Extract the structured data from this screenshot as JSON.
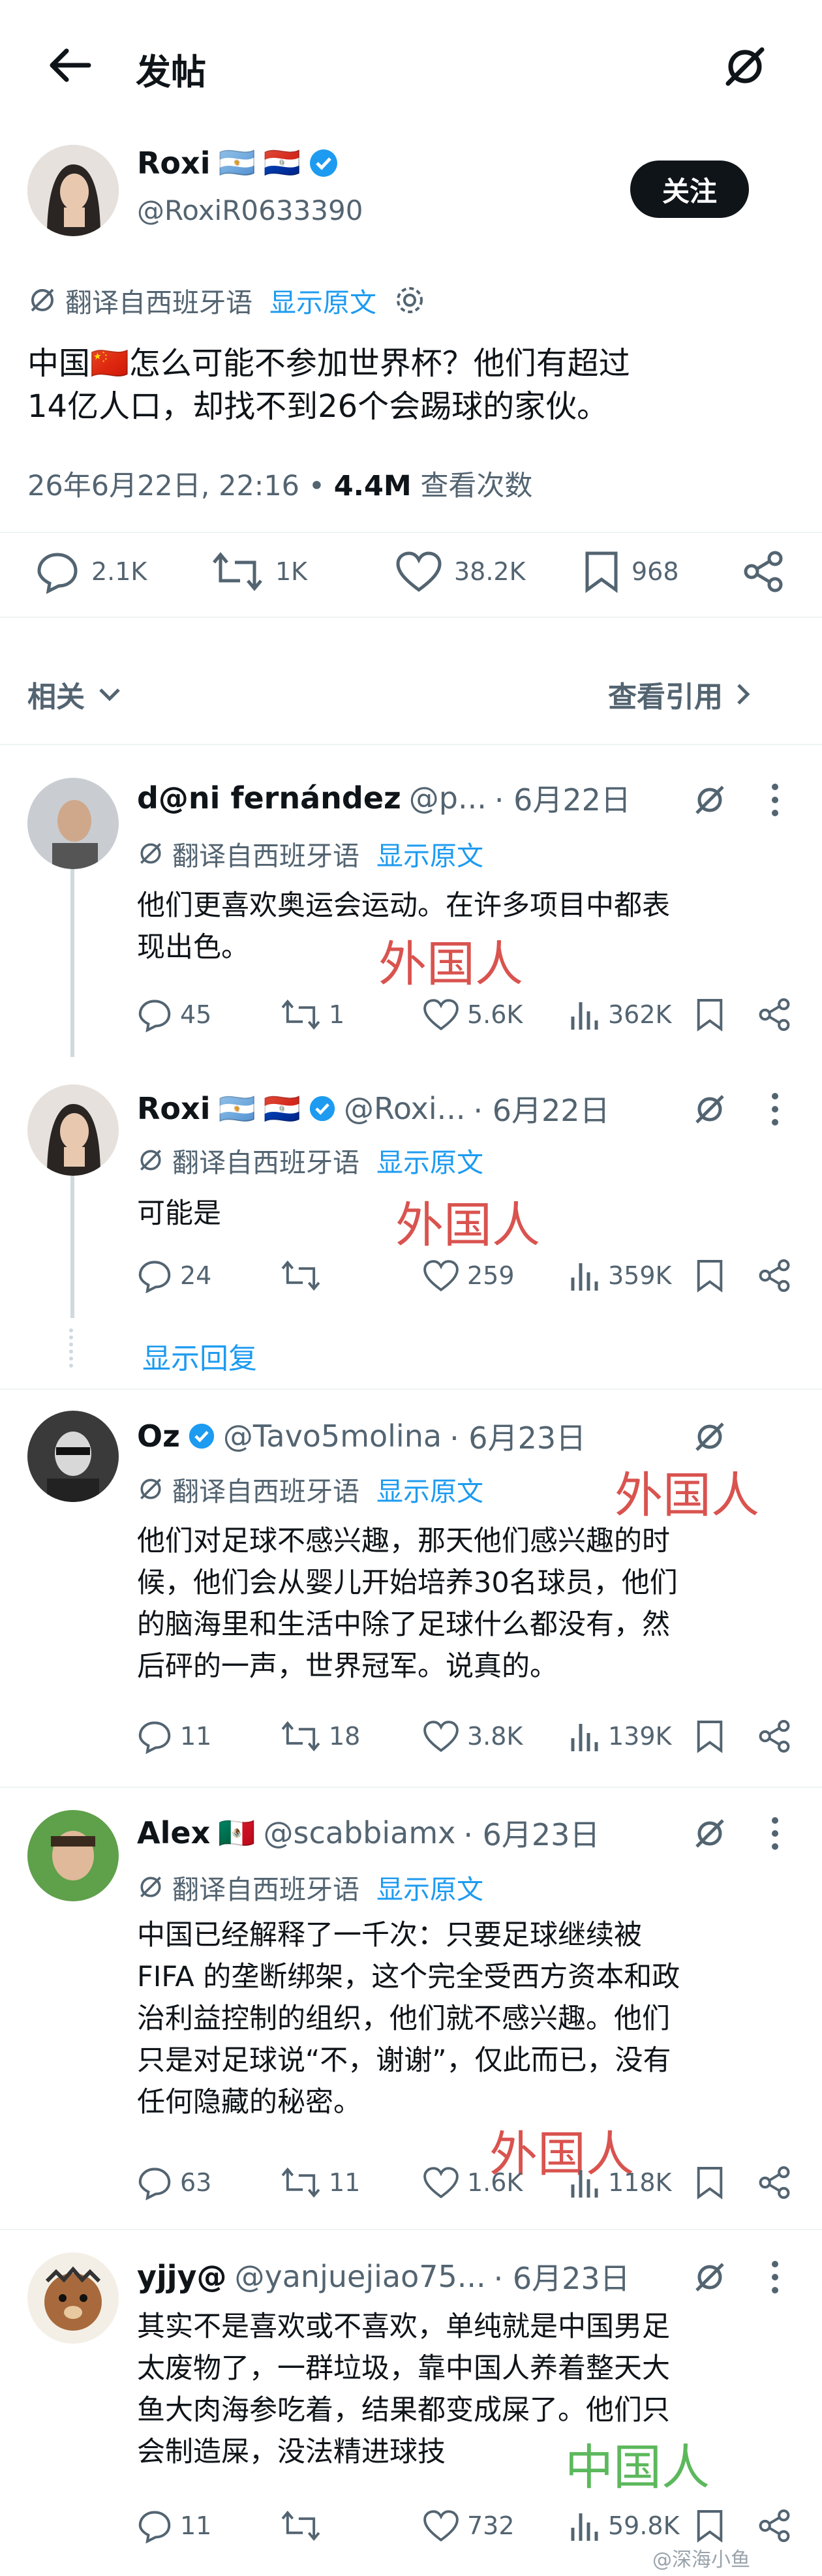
{
  "header": {
    "title": "发帖"
  },
  "post": {
    "author_name": "Roxi",
    "flags": [
      "🇦🇷",
      "🇵🇾"
    ],
    "handle": "@RoxiR0633390",
    "follow_label": "关注",
    "translate_label": "翻译自西班牙语",
    "show_original": "显示原文",
    "text_line1": "中国🇨🇳怎么可能不参加世界杯？他们有超过",
    "text_line2": "14亿人口，却找不到26个会踢球的家伙。",
    "timestamp": "26年6月22日, 22:16 • ",
    "views_count": "4.4M",
    "views_label": " 查看次数",
    "stats": {
      "replies": "2.1K",
      "reposts": "1K",
      "likes": "38.2K",
      "bookmarks": "968"
    }
  },
  "relevance": {
    "sort_label": "相关",
    "quotes_label": "查看引用"
  },
  "replies": [
    {
      "name": "d@ni fernández",
      "handle": "@p...",
      "date": "· 6月22日",
      "translate": "翻译自西班牙语",
      "show_original": "显示原文",
      "lines": [
        "他们更喜欢奥运会运动。在许多项目中都表",
        "现出色。"
      ],
      "stats": {
        "replies": "45",
        "reposts": "1",
        "likes": "5.6K",
        "views": "362K"
      },
      "annotation": "外国人"
    },
    {
      "name": "Roxi",
      "flags": [
        "🇦🇷",
        "🇵🇾"
      ],
      "handle": "@Roxi...",
      "date": "· 6月22日",
      "translate": "翻译自西班牙语",
      "show_original": "显示原文",
      "lines": [
        "可能是"
      ],
      "stats": {
        "replies": "24",
        "reposts": "",
        "likes": "259",
        "views": "359K"
      },
      "annotation": "外国人"
    },
    {
      "name": "Oz",
      "handle": "@Tavo5molina",
      "date": "· 6月23日",
      "translate": "翻译自西班牙语",
      "show_original": "显示原文",
      "lines": [
        "他们对足球不感兴趣，那天他们感兴趣的时",
        "候，他们会从婴儿开始培养30名球员，他们",
        "的脑海里和生活中除了足球什么都没有，然",
        "后砰的一声，世界冠军。说真的。"
      ],
      "stats": {
        "replies": "11",
        "reposts": "18",
        "likes": "3.8K",
        "views": "139K"
      },
      "annotation": "外国人"
    },
    {
      "name": "Alex",
      "flags": [
        "🇲🇽"
      ],
      "handle": "@scabbiamx",
      "date": "· 6月23日",
      "translate": "翻译自西班牙语",
      "show_original": "显示原文",
      "lines": [
        "中国已经解释了一千次：只要足球继续被",
        "FIFA 的垄断绑架，这个完全受西方资本和政",
        "治利益控制的组织，他们就不感兴趣。他们",
        "只是对足球说“不，谢谢”，仅此而已，没有",
        "任何隐藏的秘密。"
      ],
      "stats": {
        "replies": "63",
        "reposts": "11",
        "likes": "1.6K",
        "views": "118K"
      },
      "annotation": "外国人"
    },
    {
      "name": "yjjy@",
      "handle": "@yanjuejiao75...",
      "date": "· 6月23日",
      "lines": [
        "其实不是喜欢或不喜欢，单纯就是中国男足",
        "太废物了，一群垃圾，靠中国人养着整天大",
        "鱼大肉海参吃着，结果都变成屎了。他们只",
        "会制造屎，没法精进球技"
      ],
      "stats": {
        "replies": "11",
        "reposts": "",
        "likes": "732",
        "views": "59.8K"
      },
      "annotation": "中国人"
    }
  ],
  "show_replies": "显示回复",
  "watermark": "@深海小鱼",
  "colors": {
    "accent": "#1d9bf0",
    "annotation_red": "#d9534f",
    "annotation_green": "#5cb85c",
    "verified": "#1d9bf0"
  }
}
